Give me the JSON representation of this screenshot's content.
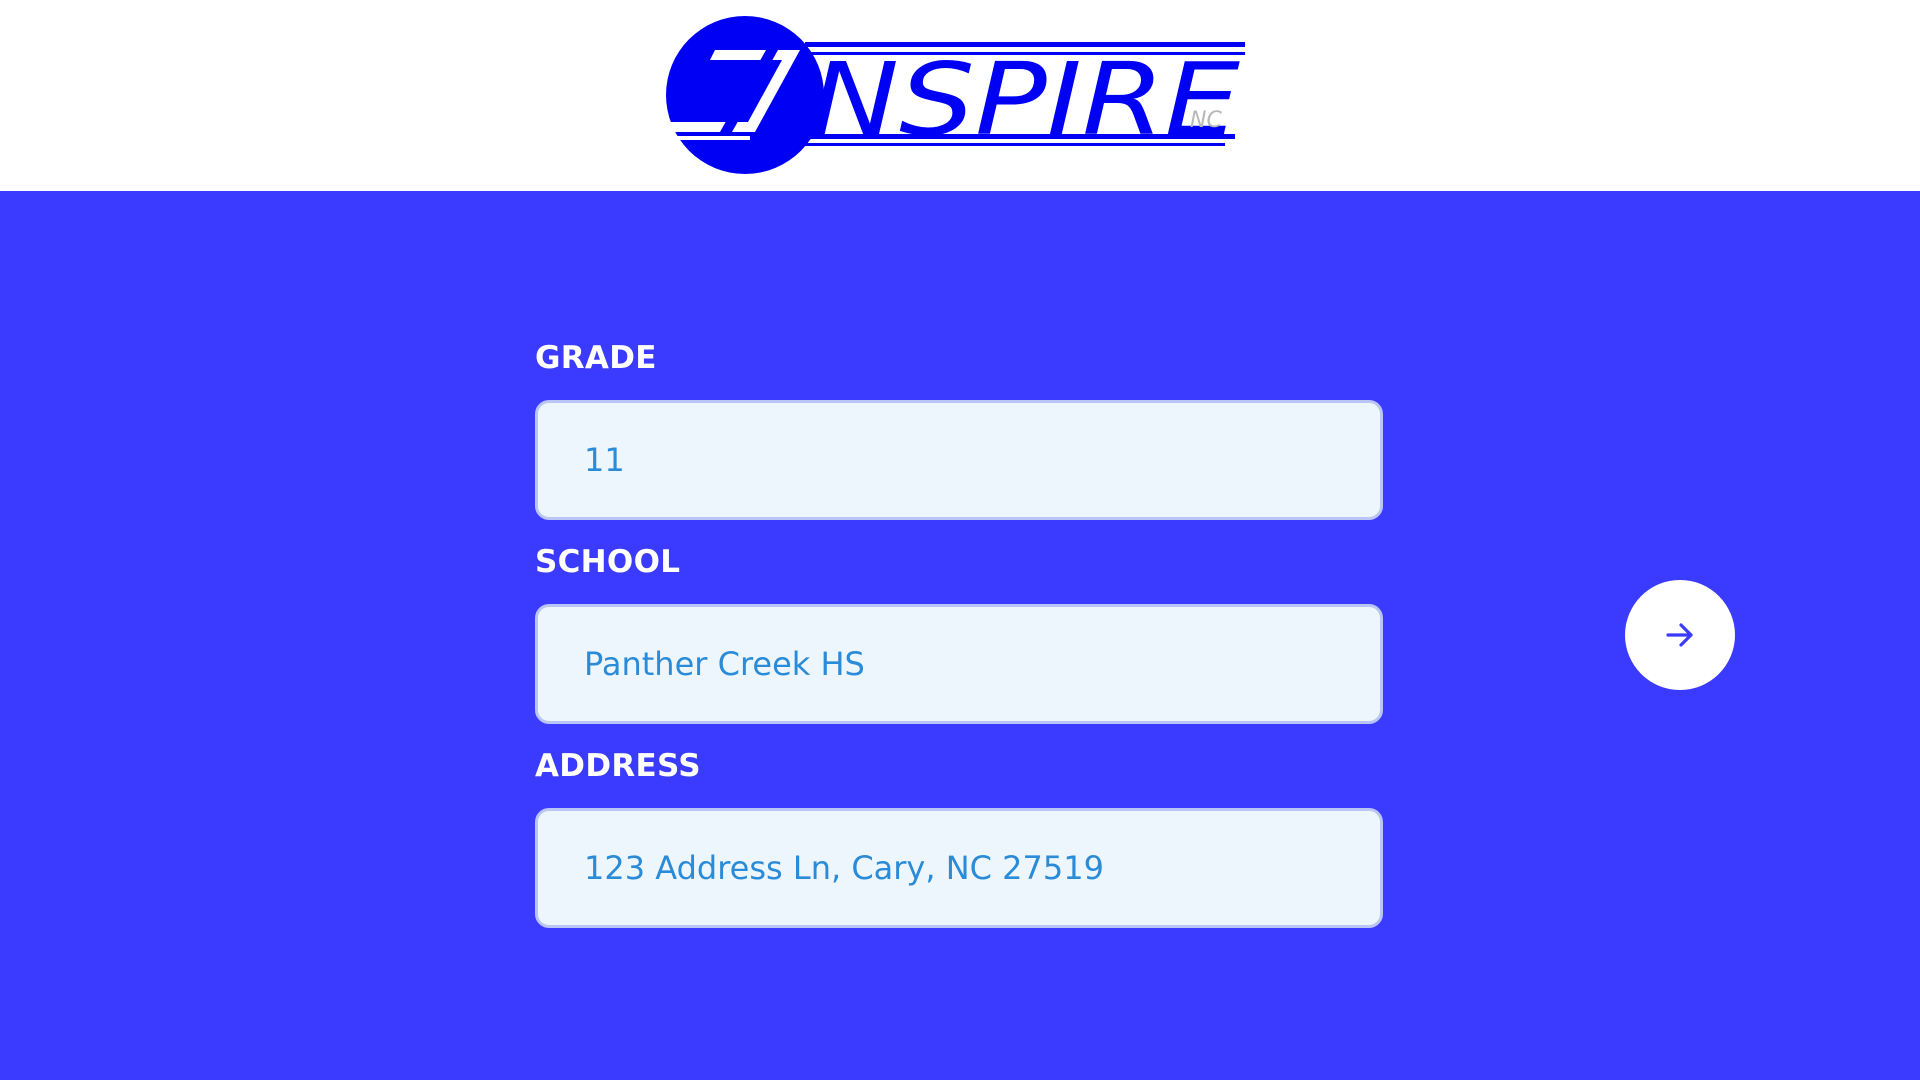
{
  "logo": {
    "text": "NSPIRE",
    "suffix": "NC",
    "colors": {
      "brand": "#0000f5",
      "suffix": "#b8b8b8"
    }
  },
  "form": {
    "grade": {
      "label": "GRADE",
      "value": "11"
    },
    "school": {
      "label": "SCHOOL",
      "value": "Panther Creek HS"
    },
    "address": {
      "label": "ADDRESS",
      "value": "123 Address Ln, Cary, NC 27519"
    }
  },
  "next_button": {
    "icon": "arrow-right-icon"
  },
  "colors": {
    "background": "#3b3bff",
    "header": "#ffffff",
    "input_background": "#eef6fd",
    "input_text": "#2a8bd8",
    "label_text": "#ffffff"
  }
}
